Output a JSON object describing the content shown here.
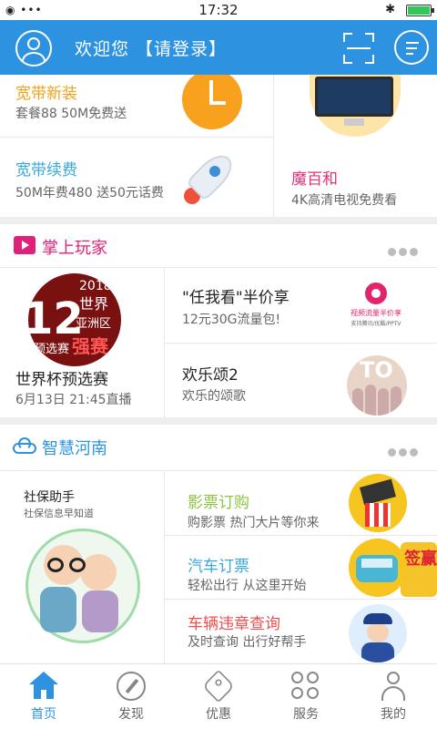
{
  "status_bar": {
    "time": "17:32"
  },
  "header": {
    "greeting": "欢迎您 【请登录】"
  },
  "top_card": {
    "items": [
      {
        "title": "宽带新装",
        "subtitle": "套餐88 50M免费送",
        "color": "#f0a21e"
      },
      {
        "title": "宽带续费",
        "subtitle": "50M年费480 送50元话费",
        "color": "#38a9dc"
      },
      {
        "title": "魔百和",
        "subtitle": "4K高清电视免费看",
        "color": "#e5307a"
      }
    ]
  },
  "entertainment": {
    "title": "掌上玩家",
    "featured": {
      "title": "世界杯预选赛",
      "subtitle": "6月13日 21:45直播",
      "image": {
        "number": "12",
        "year": "2018",
        "line1": "世界",
        "line2": "亚洲区",
        "line3": "预选赛",
        "line4": "强赛"
      }
    },
    "items": [
      {
        "title": "\"任我看\"半价享",
        "subtitle": "12元30G流量包!",
        "logo_line1": "视频流量半价享",
        "logo_line2": "支持腾讯/优酷/PPTV"
      },
      {
        "title": "欢乐颂2",
        "subtitle": "欢乐的颂歌",
        "logo_text": "TO"
      }
    ]
  },
  "smart": {
    "title": "智慧河南",
    "featured": {
      "title": "社保助手",
      "subtitle": "社保信息早知道"
    },
    "items": [
      {
        "title": "影票订购",
        "subtitle": "购影票 热门大片等你来",
        "color": "#8cc63f"
      },
      {
        "title": "汽车订票",
        "subtitle": "轻松出行 从这里开始",
        "color": "#38a9dc"
      },
      {
        "title": "车辆违章查询",
        "subtitle": "及时查询 出行好帮手",
        "color": "#f04e4e"
      }
    ],
    "side_promo": "签赢"
  },
  "bottom_nav": [
    {
      "label": "首页",
      "icon": "home-icon",
      "active": true
    },
    {
      "label": "发现",
      "icon": "compass-icon",
      "active": false
    },
    {
      "label": "优惠",
      "icon": "tag-icon",
      "active": false
    },
    {
      "label": "服务",
      "icon": "grid-icon",
      "active": false
    },
    {
      "label": "我的",
      "icon": "user-icon",
      "active": false
    }
  ],
  "colors": {
    "brand": "#2d93e0",
    "entertainment_accent": "#e0217a"
  }
}
